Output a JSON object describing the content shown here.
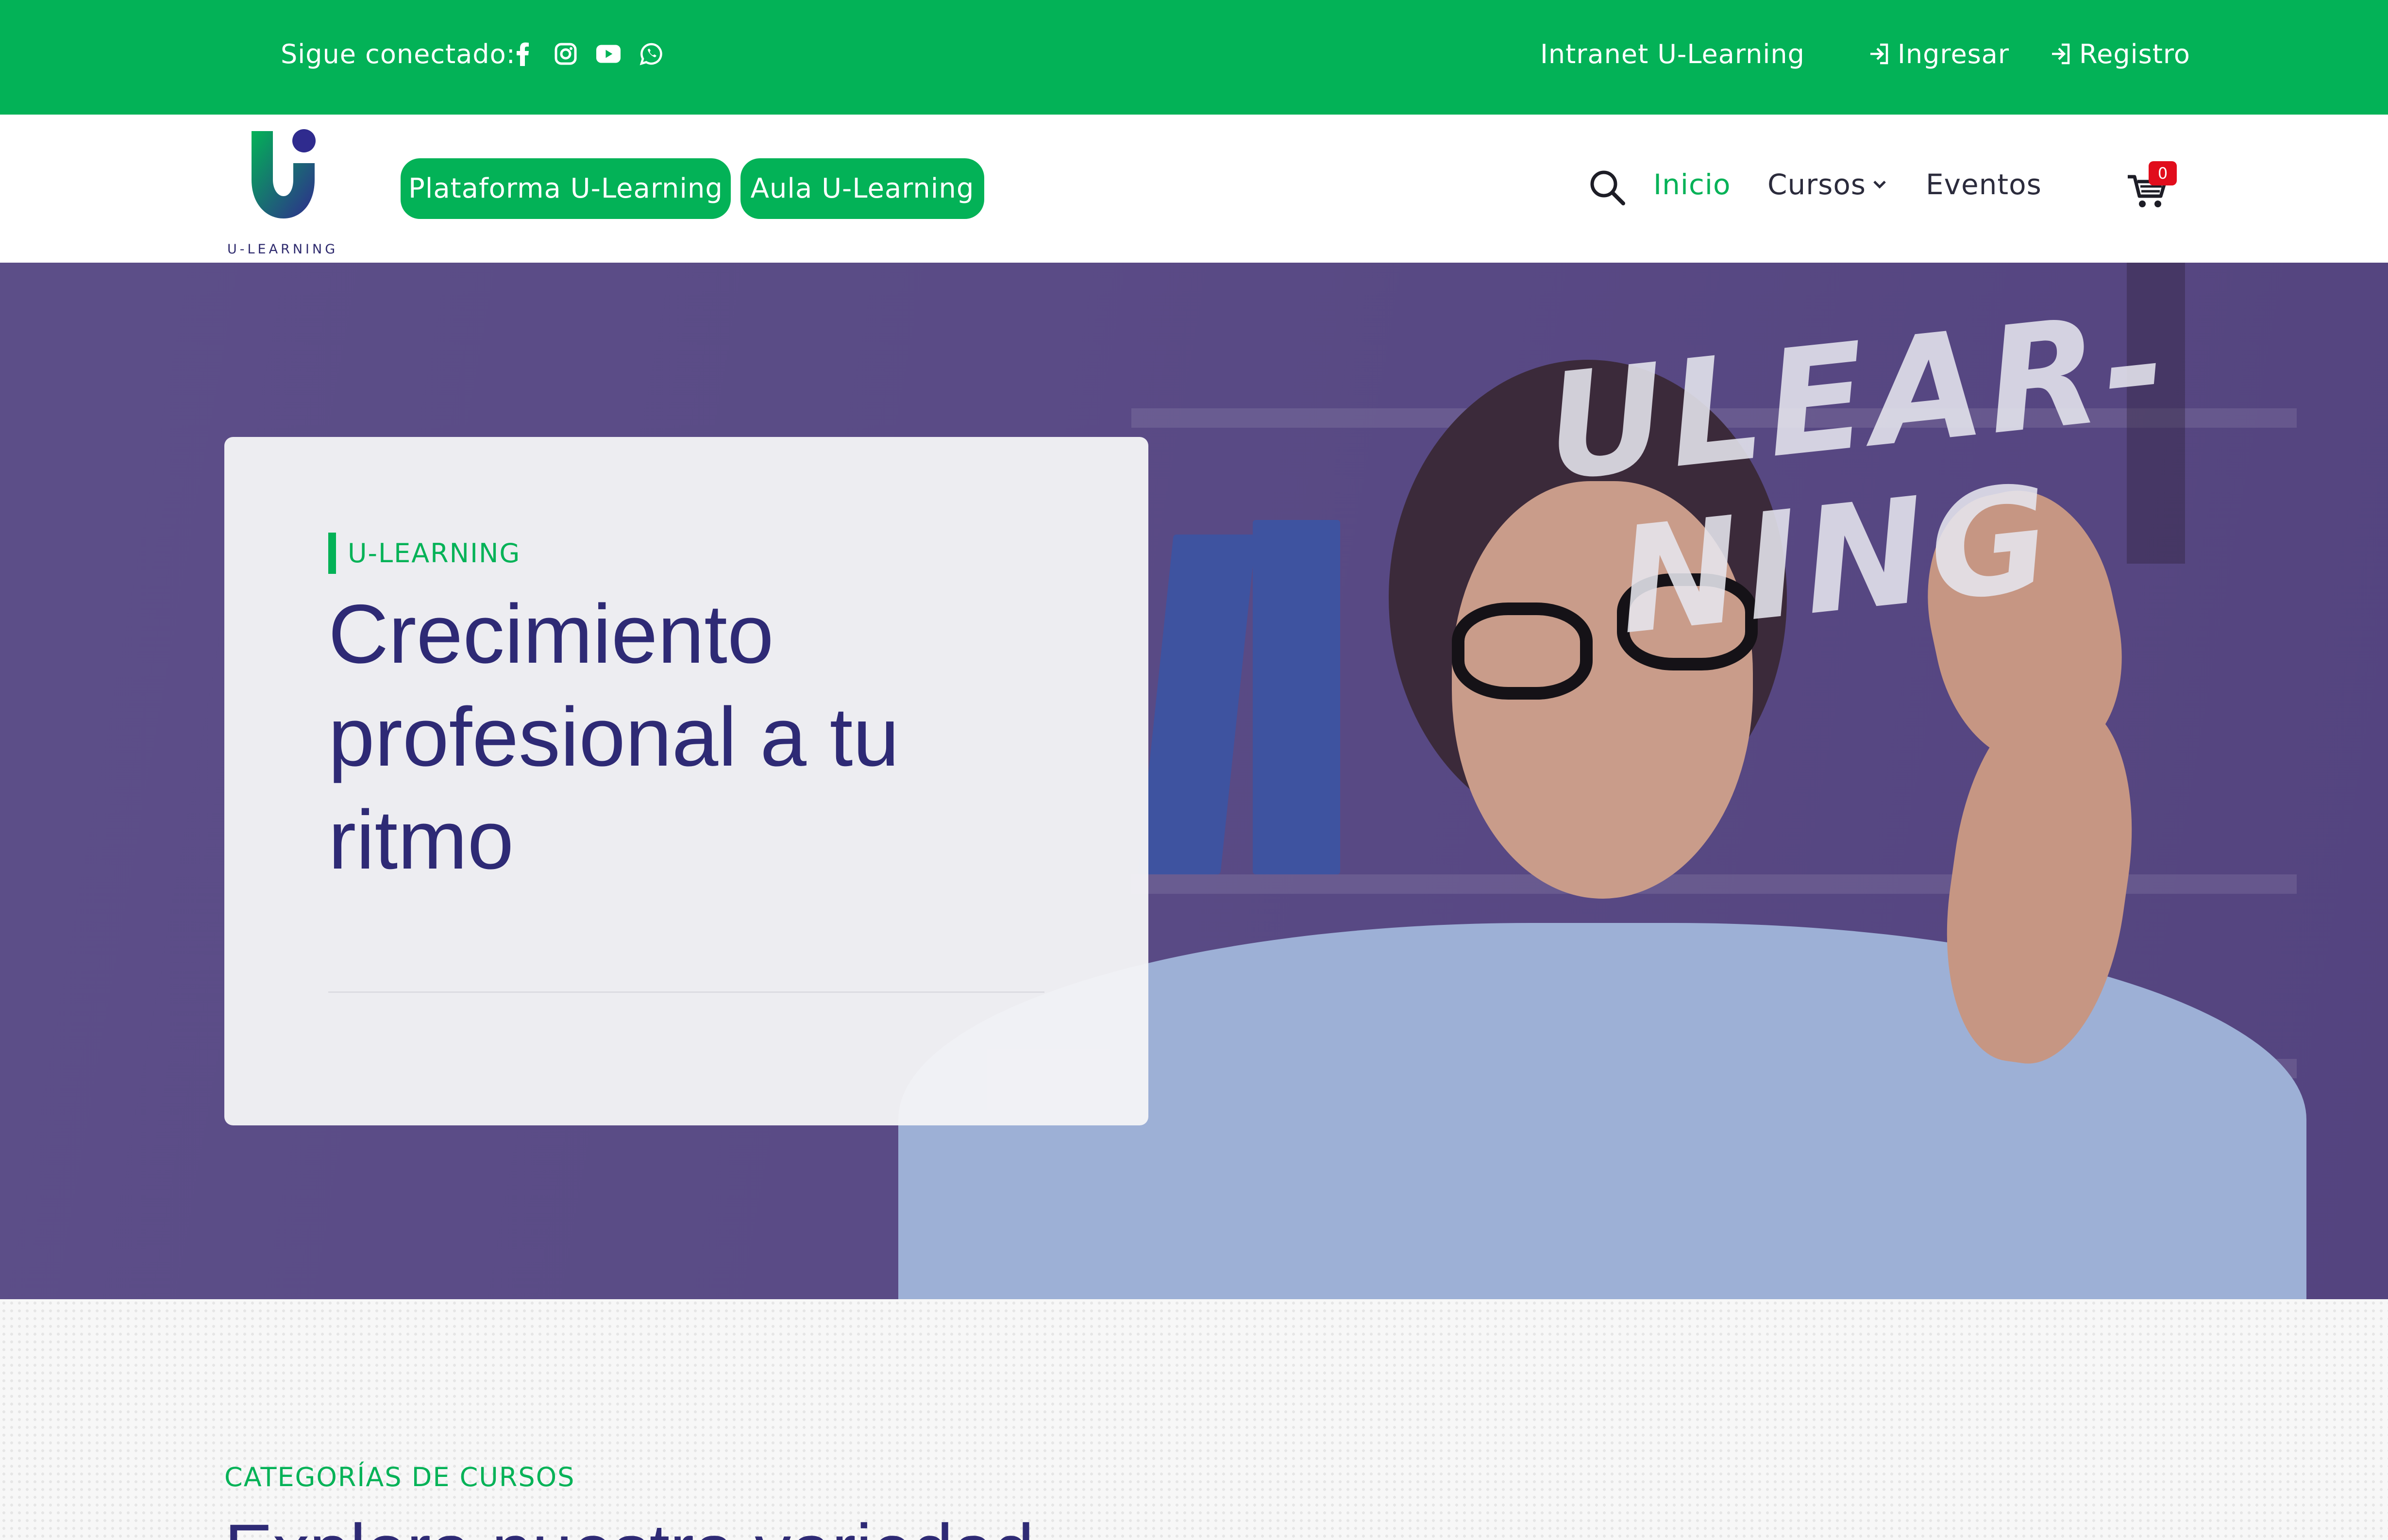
{
  "topbar": {
    "follow_label": "Sigue conectado:",
    "socials": [
      "facebook-icon",
      "instagram-icon",
      "youtube-icon",
      "whatsapp-icon"
    ],
    "intranet_label": "Intranet U-Learning",
    "login_label": "Ingresar",
    "register_label": "Registro"
  },
  "navbar": {
    "logo_text": "U-LEARNING",
    "platform_button": "Plataforma U-Learning",
    "aula_button": "Aula U-Learning",
    "links": {
      "inicio": "Inicio",
      "cursos": "Cursos",
      "eventos": "Eventos"
    },
    "cart_count": "0"
  },
  "hero": {
    "kicker": "U-LEARNING",
    "headline": "Crecimiento profesional a tu ritmo",
    "image_handwriting": "ULEAR-\n NING"
  },
  "categories": {
    "kicker": "CATEGORÍAS DE CURSOS",
    "title": "Explora nuestra variedad"
  },
  "colors": {
    "brand_green": "#03b257",
    "brand_purple": "#2e2a75",
    "hero_overlay": "#5a4b86",
    "badge_red": "#e10d1c"
  }
}
